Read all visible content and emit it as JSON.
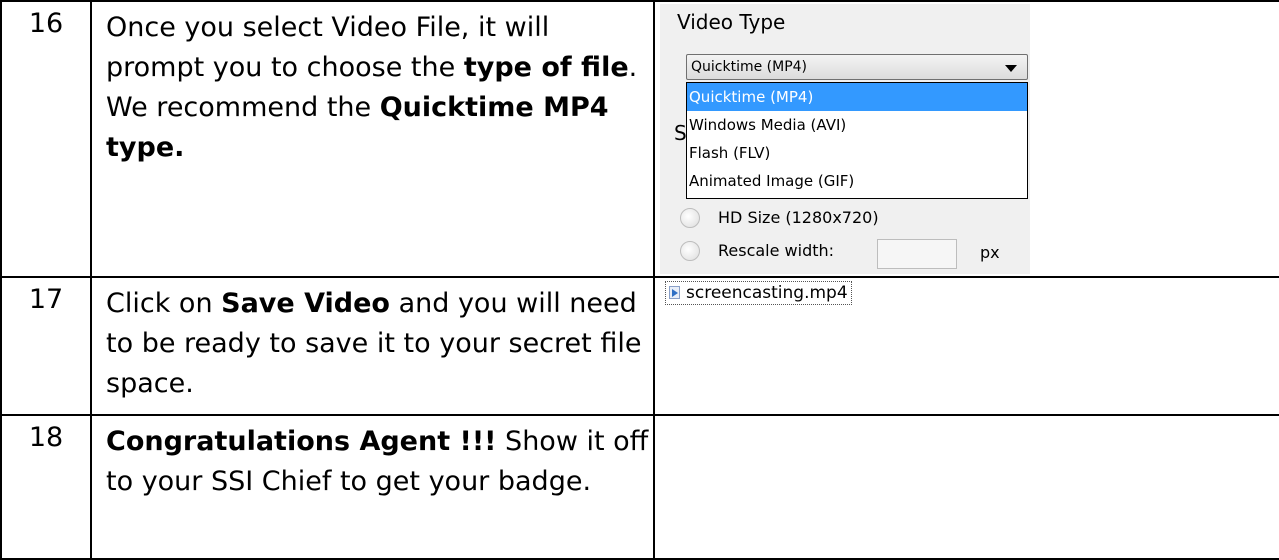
{
  "steps": [
    {
      "number": "16",
      "text_parts": [
        {
          "text": "Once you select Video File, it will prompt you to choose the ",
          "bold": false
        },
        {
          "text": "type of file",
          "bold": true
        },
        {
          "text": ". We recommend the ",
          "bold": false
        },
        {
          "text": "Quicktime MP4 type.",
          "bold": true
        }
      ]
    },
    {
      "number": "17",
      "text_parts": [
        {
          "text": "Click on ",
          "bold": false
        },
        {
          "text": "Save Video",
          "bold": true
        },
        {
          "text": " and you will need to be ready to save it to your secret file space.",
          "bold": false
        }
      ]
    },
    {
      "number": "18",
      "text_parts": [
        {
          "text": "Congratulations Agent !!!",
          "bold": true
        },
        {
          "text": " Show it off to your SSI Chief to get your badge.",
          "bold": false
        }
      ]
    }
  ],
  "video_type_panel": {
    "title": "Video Type",
    "selected": "Quicktime (MP4)",
    "options": [
      "Quicktime (MP4)",
      "Windows Media (AVI)",
      "Flash (FLV)",
      "Animated Image (GIF)"
    ],
    "hidden_section_initial": "S",
    "radio_hd_label": "HD Size (1280x720)",
    "radio_rescale_label": "Rescale width:",
    "rescale_value": "",
    "px_unit": "px",
    "dropdown_icon": "chevron-down-icon",
    "selected_color": "#3399ff"
  },
  "saved_file": {
    "name": "screencasting.mp4",
    "icon": "media-file-icon"
  }
}
